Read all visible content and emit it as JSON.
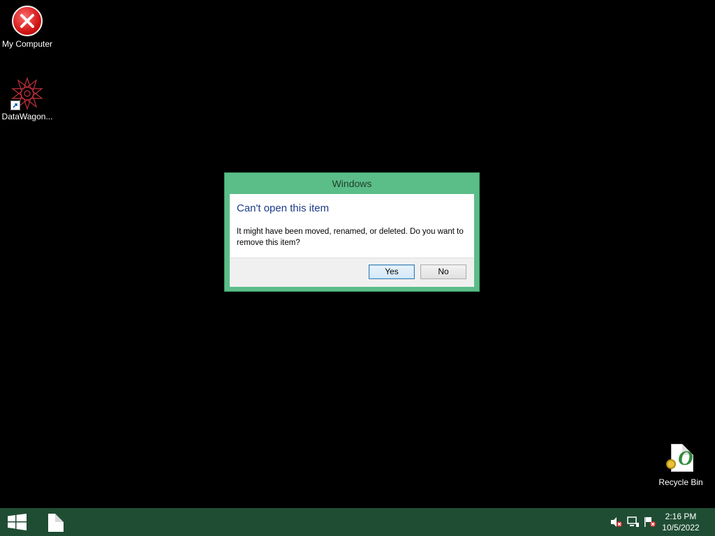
{
  "desktop": {
    "icons": [
      {
        "label": "My Computer",
        "icon": "error-x-icon"
      },
      {
        "label": "DataWagon...",
        "icon": "datawagon-app-icon"
      },
      {
        "label": "Recycle Bin",
        "icon": "recycle-bin-icon"
      }
    ]
  },
  "dialog": {
    "title": "Windows",
    "heading": "Can't open this item",
    "message": "It might have been moved, renamed, or deleted. Do you want to remove this item?",
    "yes_label": "Yes",
    "no_label": "No",
    "colors": {
      "frame": "#5bbd88",
      "heading": "#1d3b8a"
    }
  },
  "taskbar": {
    "start_icon": "windows-logo-icon",
    "pinned_app_icon": "document-icon",
    "tray_icons": [
      "speaker-muted-icon",
      "network-icon",
      "action-center-flag-icon"
    ],
    "time": "2:16 PM",
    "date": "10/5/2022",
    "color": "#1f4d33"
  }
}
